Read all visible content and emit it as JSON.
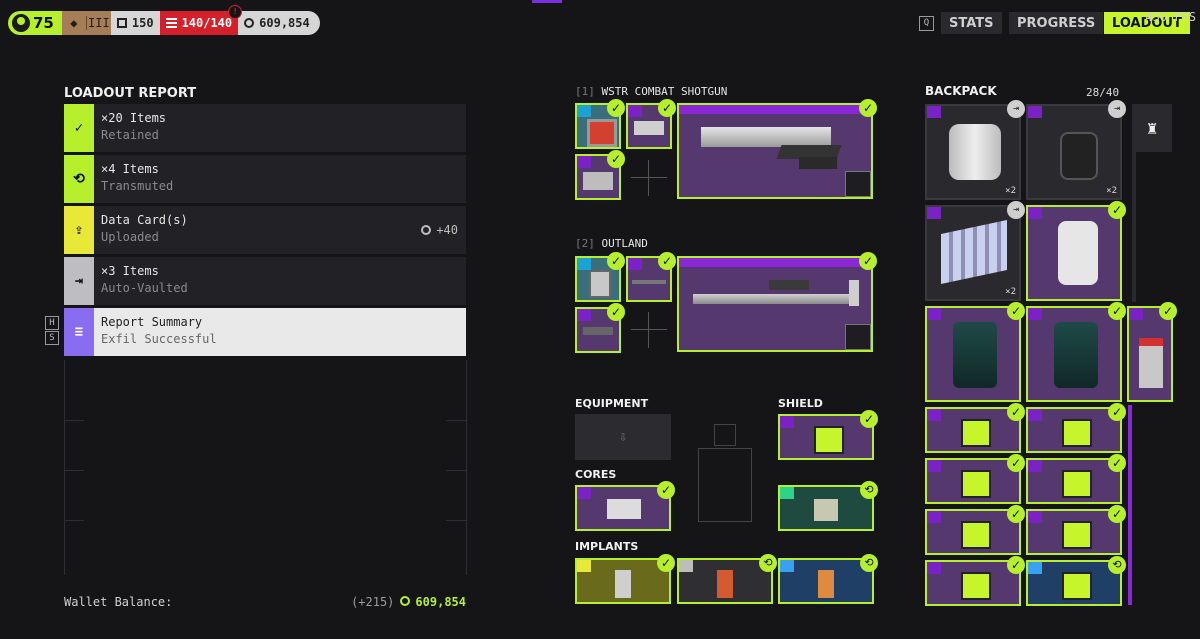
{
  "topbar": {
    "level": "75",
    "rank": [
      "◆",
      "III"
    ],
    "vault_count": "150",
    "capacity": "140/140",
    "warning_icon": "!",
    "credits": "609,854"
  },
  "nav": {
    "key_hint": "Q",
    "stats_label": "STATS",
    "progress_label": "PROGRESS",
    "loadout_label": "LOADOUT",
    "fps_text": "430 FPS"
  },
  "report": {
    "title": "LOADOUT REPORT",
    "rows": [
      {
        "line1": "×20 Items",
        "line2": "Retained",
        "color": "#b6f02c",
        "icon": "check-icon",
        "glyph": "✓",
        "extra": ""
      },
      {
        "line1": "×4 Items",
        "line2": "Transmuted",
        "color": "#b6f02c",
        "icon": "transmute-icon",
        "glyph": "⟲",
        "extra": ""
      },
      {
        "line1": "Data Card(s)",
        "line2": "Uploaded",
        "color": "#e8e838",
        "icon": "upload-icon",
        "glyph": "⇪",
        "extra": "+40"
      },
      {
        "line1": "×3 Items",
        "line2": "Auto-Vaulted",
        "color": "#bdbdc2",
        "icon": "vault-icon",
        "glyph": "⇥",
        "extra": ""
      },
      {
        "line1": "Report Summary",
        "line2": "Exfil Successful",
        "color": "#8a6cf0",
        "icon": "list-icon",
        "glyph": "≡",
        "extra": ""
      }
    ],
    "hotkeys": [
      "H",
      "S"
    ],
    "wallet_label": "Wallet Balance:",
    "wallet_delta": "(+215)",
    "wallet_balance": "609,854"
  },
  "weapons": [
    {
      "slot": "[1]",
      "name": "WSTR COMBAT SHOTGUN"
    },
    {
      "slot": "[2]",
      "name": "OUTLAND"
    }
  ],
  "sections": {
    "equipment": "EQUIPMENT",
    "shield": "SHIELD",
    "cores": "CORES",
    "implants": "IMPLANTS"
  },
  "backpack": {
    "title": "BACKPACK",
    "count": "28/40",
    "qty_labels": [
      "×2",
      "×2",
      "×2"
    ]
  },
  "colors": {
    "accent": "#b6f02c",
    "purple": "#8a28d8",
    "red": "#d4202a"
  }
}
